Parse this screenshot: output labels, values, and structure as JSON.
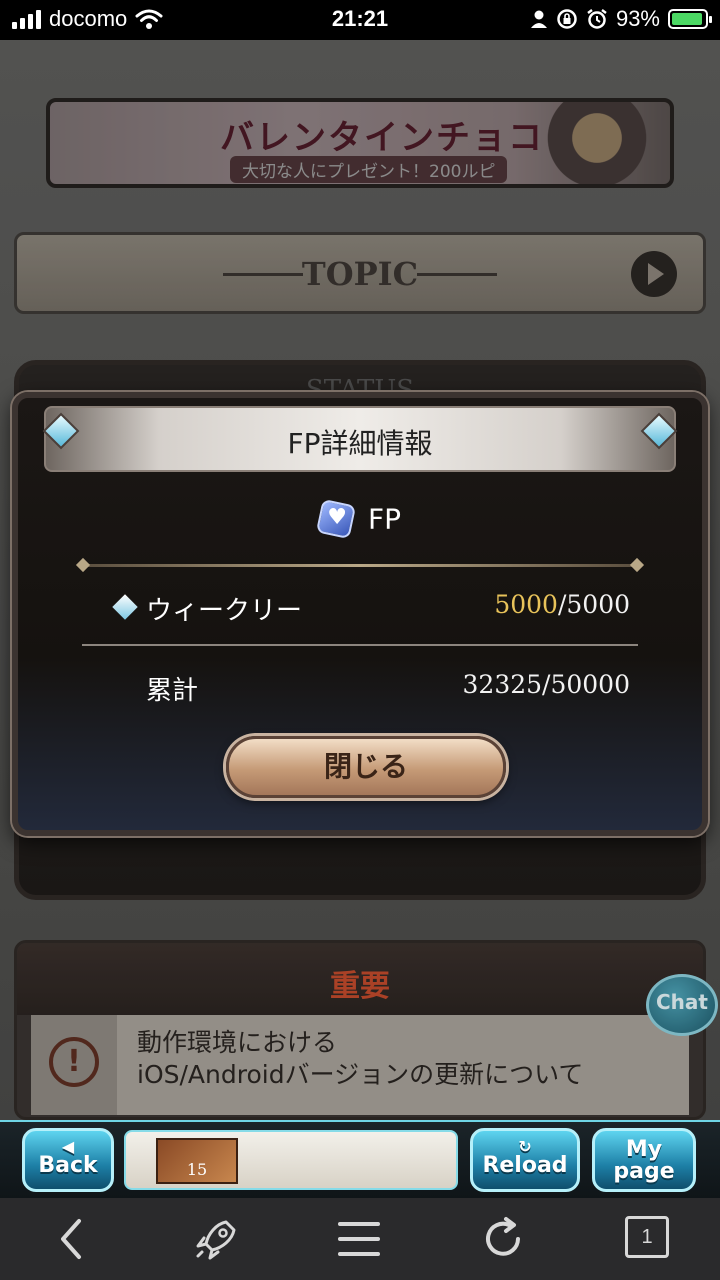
{
  "status_bar": {
    "carrier": "docomo",
    "time": "21:21",
    "battery_percent": "93%",
    "battery_level": 0.93,
    "icons": [
      "signal-icon",
      "wifi-icon",
      "person-icon",
      "rotation-lock-icon",
      "alarm-icon",
      "battery-charging-icon"
    ]
  },
  "banner": {
    "title": "バレンタインチョコ",
    "subtitle": "大切な人にプレゼント！200ルピ"
  },
  "topic": {
    "label": "TOPIC"
  },
  "status_panel": {
    "title": "STATUS"
  },
  "modal": {
    "title": "FP詳細情報",
    "fp_label": "FP",
    "weekly": {
      "label": "ウィークリー",
      "current": "5000",
      "max": "/5000"
    },
    "total": {
      "label": "累計",
      "value": "32325/50000"
    },
    "close_label": "閉じる"
  },
  "important": {
    "title": "重要",
    "notice_line1": "動作環境における",
    "notice_line2": "iOS/Androidバージョンの更新について"
  },
  "chat": {
    "label": "Chat"
  },
  "game_nav": {
    "back_label": "Back",
    "reload_label": "Reload",
    "mypage_label_1": "My",
    "mypage_label_2": "page",
    "thumb_number": "15"
  },
  "browser_toolbar": {
    "tab_count": "1"
  },
  "colors": {
    "accent_gold": "#e8c35a",
    "notice_red": "#c24a2c",
    "nav_cyan": "#5ed4ef"
  }
}
